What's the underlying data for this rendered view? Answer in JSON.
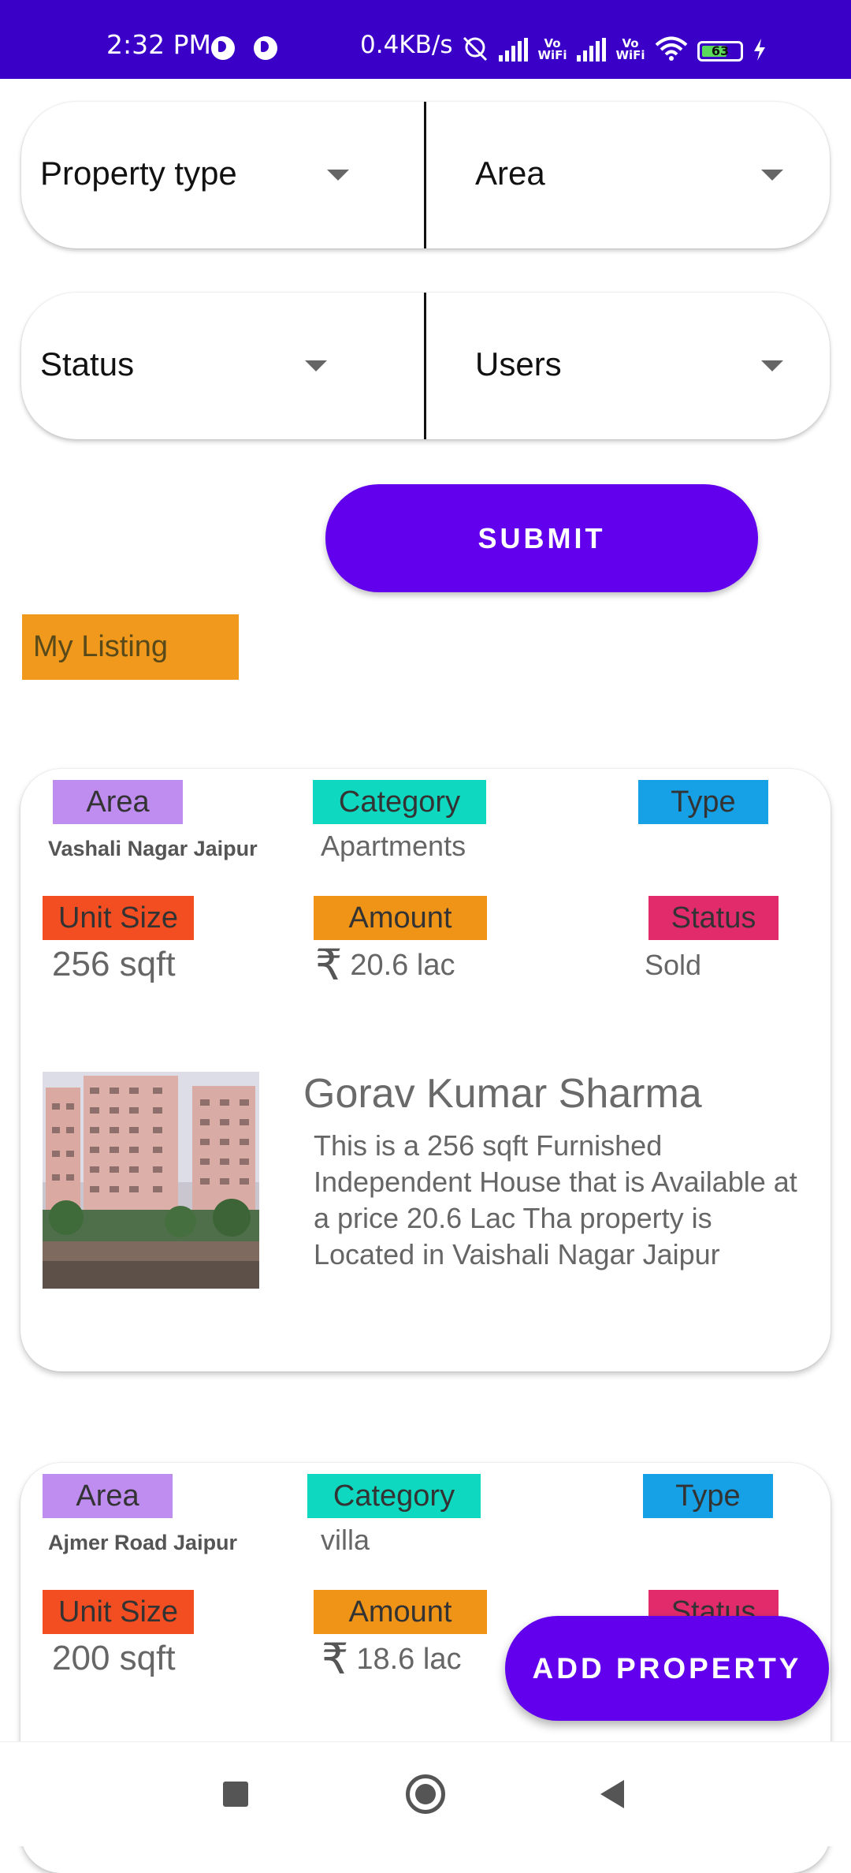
{
  "status_bar": {
    "time": "2:32 PM",
    "network_speed": "0.4KB/s",
    "vowifi_1": "Vo WiFi",
    "vowifi_2": "Vo WiFi",
    "battery": "63"
  },
  "filters": {
    "property_type": "Property type",
    "area": "Area",
    "status": "Status",
    "users": "Users"
  },
  "submit_label": "SUBMIT",
  "my_listing_label": "My Listing",
  "listings": [
    {
      "area_label": "Area",
      "area_value": "Vashali Nagar Jaipur",
      "category_label": "Category",
      "category_value": "Apartments",
      "type_label": "Type",
      "unit_size_label": "Unit Size",
      "unit_size_value": "256 sqft",
      "amount_label": "Amount",
      "currency_symbol": "₹",
      "amount_value": "20.6 lac",
      "status_label": "Status",
      "status_value": "Sold",
      "owner_name": "Gorav Kumar Sharma",
      "description": "This is a 256 sqft Furnished Independent House that is Available at a price 20.6 Lac Tha property is Located in Vaishali Nagar Jaipur"
    },
    {
      "area_label": "Area",
      "area_value": "Ajmer Road Jaipur",
      "category_label": "Category",
      "category_value": "villa",
      "type_label": "Type",
      "unit_size_label": "Unit Size",
      "unit_size_value": "200 sqft",
      "amount_label": "Amount",
      "currency_symbol": "₹",
      "amount_value": "18.6 lac",
      "status_label": "Status"
    }
  ],
  "fab_label": "ADD PROPERTY",
  "colors": {
    "primary": "#6200ee",
    "status_bar": "#3a00c8",
    "my_listing": "#f0991d"
  }
}
